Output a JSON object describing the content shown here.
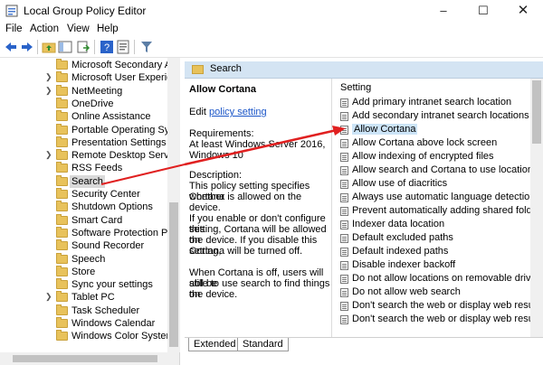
{
  "window": {
    "title": "Local Group Policy Editor"
  },
  "menu": [
    "File",
    "Action",
    "View",
    "Help"
  ],
  "tree": [
    {
      "label": "Microsoft Secondary Auth",
      "chevron": false
    },
    {
      "label": "Microsoft User Experience",
      "chevron": true
    },
    {
      "label": "NetMeeting",
      "chevron": true
    },
    {
      "label": "OneDrive",
      "chevron": false
    },
    {
      "label": "Online Assistance",
      "chevron": false
    },
    {
      "label": "Portable Operating Syster",
      "chevron": false
    },
    {
      "label": "Presentation Settings",
      "chevron": false
    },
    {
      "label": "Remote Desktop Services",
      "chevron": true
    },
    {
      "label": "RSS Feeds",
      "chevron": false
    },
    {
      "label": "Search",
      "chevron": false,
      "selected": true
    },
    {
      "label": "Security Center",
      "chevron": false
    },
    {
      "label": "Shutdown Options",
      "chevron": false
    },
    {
      "label": "Smart Card",
      "chevron": false
    },
    {
      "label": "Software Protection Platfo",
      "chevron": false
    },
    {
      "label": "Sound Recorder",
      "chevron": false
    },
    {
      "label": "Speech",
      "chevron": false
    },
    {
      "label": "Store",
      "chevron": false
    },
    {
      "label": "Sync your settings",
      "chevron": false
    },
    {
      "label": "Tablet PC",
      "chevron": true
    },
    {
      "label": "Task Scheduler",
      "chevron": false
    },
    {
      "label": "Windows Calendar",
      "chevron": false
    },
    {
      "label": "Windows Color System",
      "chevron": false
    }
  ],
  "pane": {
    "header": "Search",
    "policy_title": "Allow Cortana",
    "edit_prefix": "Edit",
    "edit_link": "policy setting",
    "requirements_label": "Requirements:",
    "requirements_lines": [
      "At least Windows Server 2016,",
      "Windows 10"
    ],
    "description_label": "Description:",
    "description_lines": [
      "This policy setting specifies whether",
      "Cortana is allowed on the device."
    ],
    "enable_lines": [
      "If you enable or don't configure this",
      "setting, Cortana will be allowed on",
      "the device. If you disable this setting,",
      "Cortana will be turned off."
    ],
    "off_lines": [
      "When Cortana is off, users will still be",
      "able to use search to find things on",
      "the device."
    ]
  },
  "list": {
    "column_header": "Setting",
    "settings": [
      "Add primary intranet search location",
      "Add secondary intranet search locations",
      "Allow Cortana",
      "Allow Cortana above lock screen",
      "Allow indexing of encrypted files",
      "Allow search and Cortana to use location",
      "Allow use of diacritics",
      "Always use automatic language detection when",
      "Prevent automatically adding shared folders to",
      "Indexer data location",
      "Default excluded paths",
      "Default indexed paths",
      "Disable indexer backoff",
      "Do not allow locations on removable drives to b",
      "Do not allow web search",
      "Don't search the web or display web results in S",
      "Don't search the web or display web results in S"
    ],
    "highlighted_index": 2
  },
  "tabs": [
    "Extended",
    "Standard"
  ],
  "colors": {
    "header_bg": "#d4e4f3",
    "link": "#1a55c8",
    "arrow": "#e02020",
    "folder": "#e8c25b"
  }
}
